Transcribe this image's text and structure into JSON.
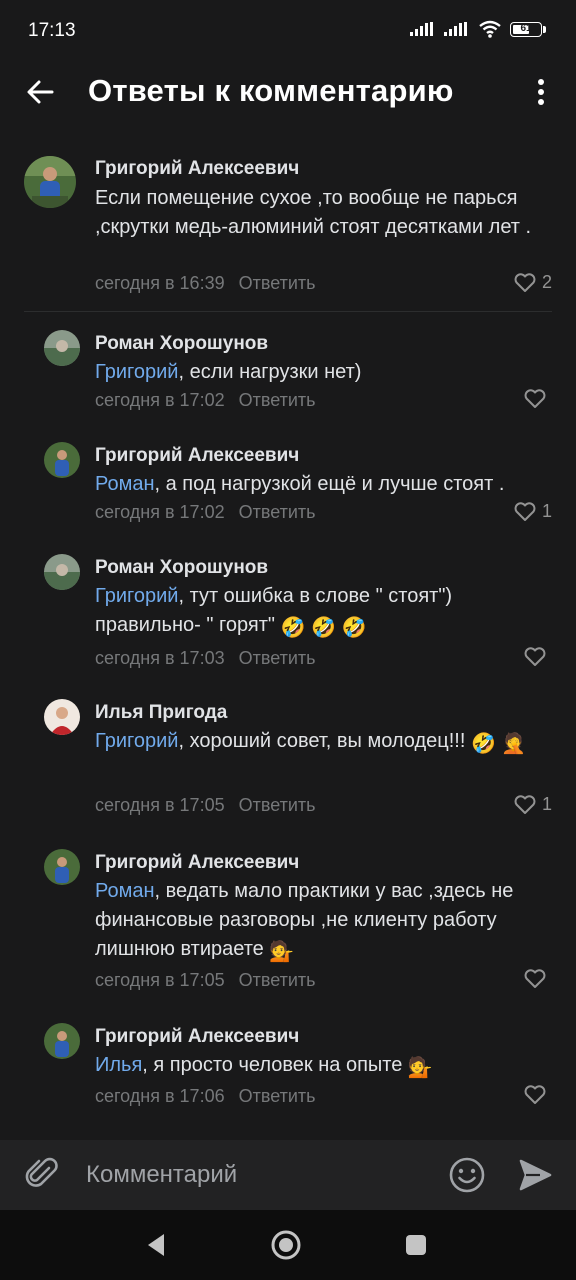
{
  "status_bar": {
    "time": "17:13",
    "battery": "61"
  },
  "header": {
    "title": "Ответы к комментарию"
  },
  "colors": {
    "background": "#19191a",
    "mention": "#71aaeb",
    "secondary": "#76787a"
  },
  "root_comment": {
    "author": "Григорий Алексеевич",
    "text": "Если помещение сухое ,то вообще не парься ,скрутки медь-алюминий стоят десятками лет .",
    "time": "сегодня в 16:39",
    "reply": "Ответить",
    "likes": "2"
  },
  "replies": [
    {
      "author": "Роман Хорошунов",
      "mention": "Григорий",
      "text": ", если нагрузки нет)",
      "time": "сегодня в 17:02",
      "reply": "Ответить",
      "likes": ""
    },
    {
      "author": "Григорий Алексеевич",
      "mention": "Роман",
      "text": ", а под нагрузкой ещё и лучше стоят .",
      "time": "сегодня в 17:02",
      "reply": "Ответить",
      "likes": "1"
    },
    {
      "author": "Роман Хорошунов",
      "mention": "Григорий",
      "text": ", тут ошибка в слове \" стоят\") правильно- \" горят\"",
      "emojis": "🤣 🤣 🤣",
      "time": "сегодня в 17:03",
      "reply": "Ответить",
      "likes": ""
    },
    {
      "author": "Илья Пригода",
      "mention": "Григорий",
      "text": ", хороший совет, вы молодец!!!",
      "emojis": "🤣 🤦",
      "time": "сегодня в 17:05",
      "reply": "Ответить",
      "likes": "1"
    },
    {
      "author": "Григорий Алексеевич",
      "mention": "Роман",
      "text": ", ведать мало практики у вас ,здесь не финансовые разговоры ,не клиенту работу лишнюю втираете",
      "emojis": "💁",
      "time": "сегодня в 17:05",
      "reply": "Ответить",
      "likes": ""
    },
    {
      "author": "Григорий Алексеевич",
      "mention": "Илья",
      "text": ", я просто человек на опыте",
      "emojis": "💁",
      "time": "сегодня в 17:06",
      "reply": "Ответить",
      "likes": ""
    }
  ],
  "composer": {
    "placeholder": "Комментарий"
  },
  "icons": {
    "back": "arrow-left-icon",
    "more": "more-vertical-icon",
    "like": "heart-icon",
    "attach": "paperclip-icon",
    "emoji": "smile-icon",
    "send": "send-icon",
    "nav_back": "triangle-back-icon",
    "nav_home": "circle-home-icon",
    "nav_recent": "square-recent-icon"
  }
}
